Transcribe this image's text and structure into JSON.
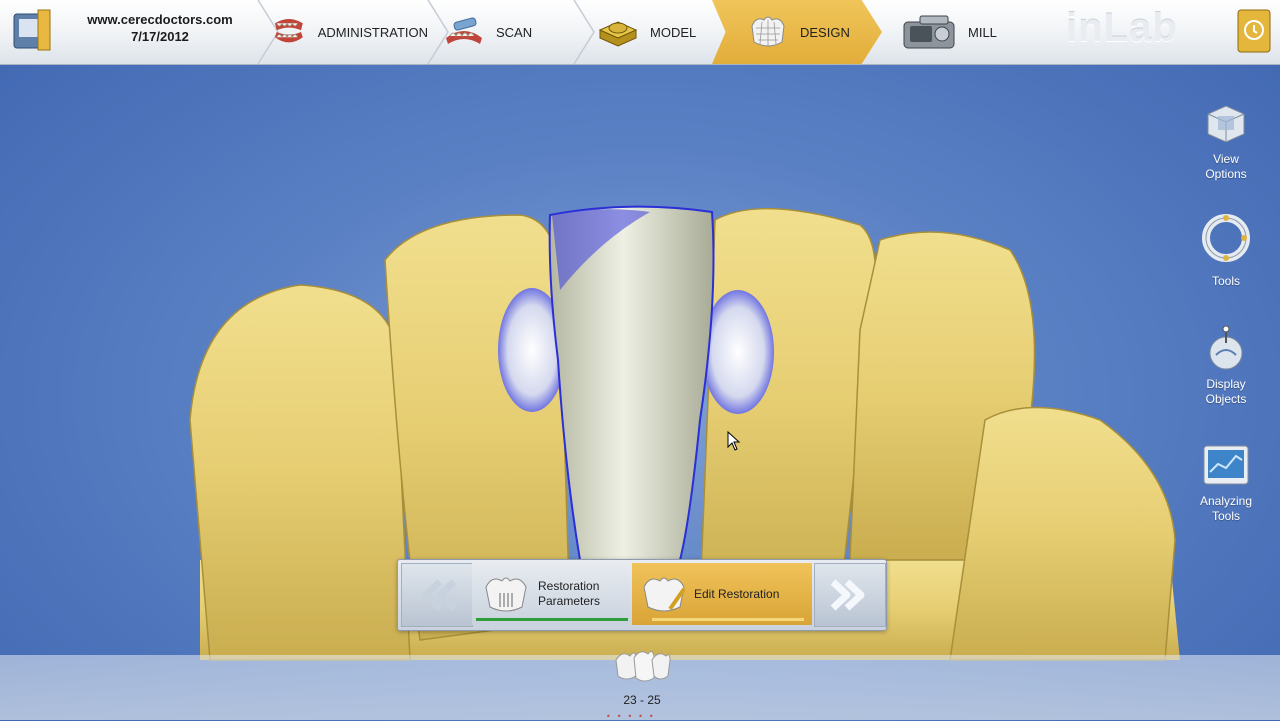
{
  "header": {
    "site": "www.cerecdoctors.com",
    "date": "7/17/2012",
    "brand": "inLab",
    "steps": [
      {
        "label": "ADMINISTRATION",
        "icon": "administration-teeth-icon"
      },
      {
        "label": "SCAN",
        "icon": "scan-teeth-icon"
      },
      {
        "label": "MODEL",
        "icon": "model-block-icon"
      },
      {
        "label": "DESIGN",
        "icon": "design-crown-icon",
        "active": true
      },
      {
        "label": "MILL",
        "icon": "mill-machine-icon"
      }
    ],
    "active_color": "#e2ad3a"
  },
  "side_tools": [
    {
      "line1": "View",
      "line2": "Options",
      "icon": "cube-view-icon"
    },
    {
      "line1": "Tools",
      "line2": "",
      "icon": "tools-ring-icon"
    },
    {
      "line1": "Display",
      "line2": "Objects",
      "icon": "display-objects-icon"
    },
    {
      "line1": "Analyzing",
      "line2": "Tools",
      "icon": "analyzing-monitor-icon"
    }
  ],
  "wizard": {
    "prev_icon": "double-chevron-left-icon",
    "next_icon": "double-chevron-right-icon",
    "step_done_line1": "Restoration",
    "step_done_line2": "Parameters",
    "step_active": "Edit Restoration",
    "done_color": "#2e9e3a",
    "active_color": "#e0a833"
  },
  "bottom": {
    "range": "23 - 25"
  }
}
